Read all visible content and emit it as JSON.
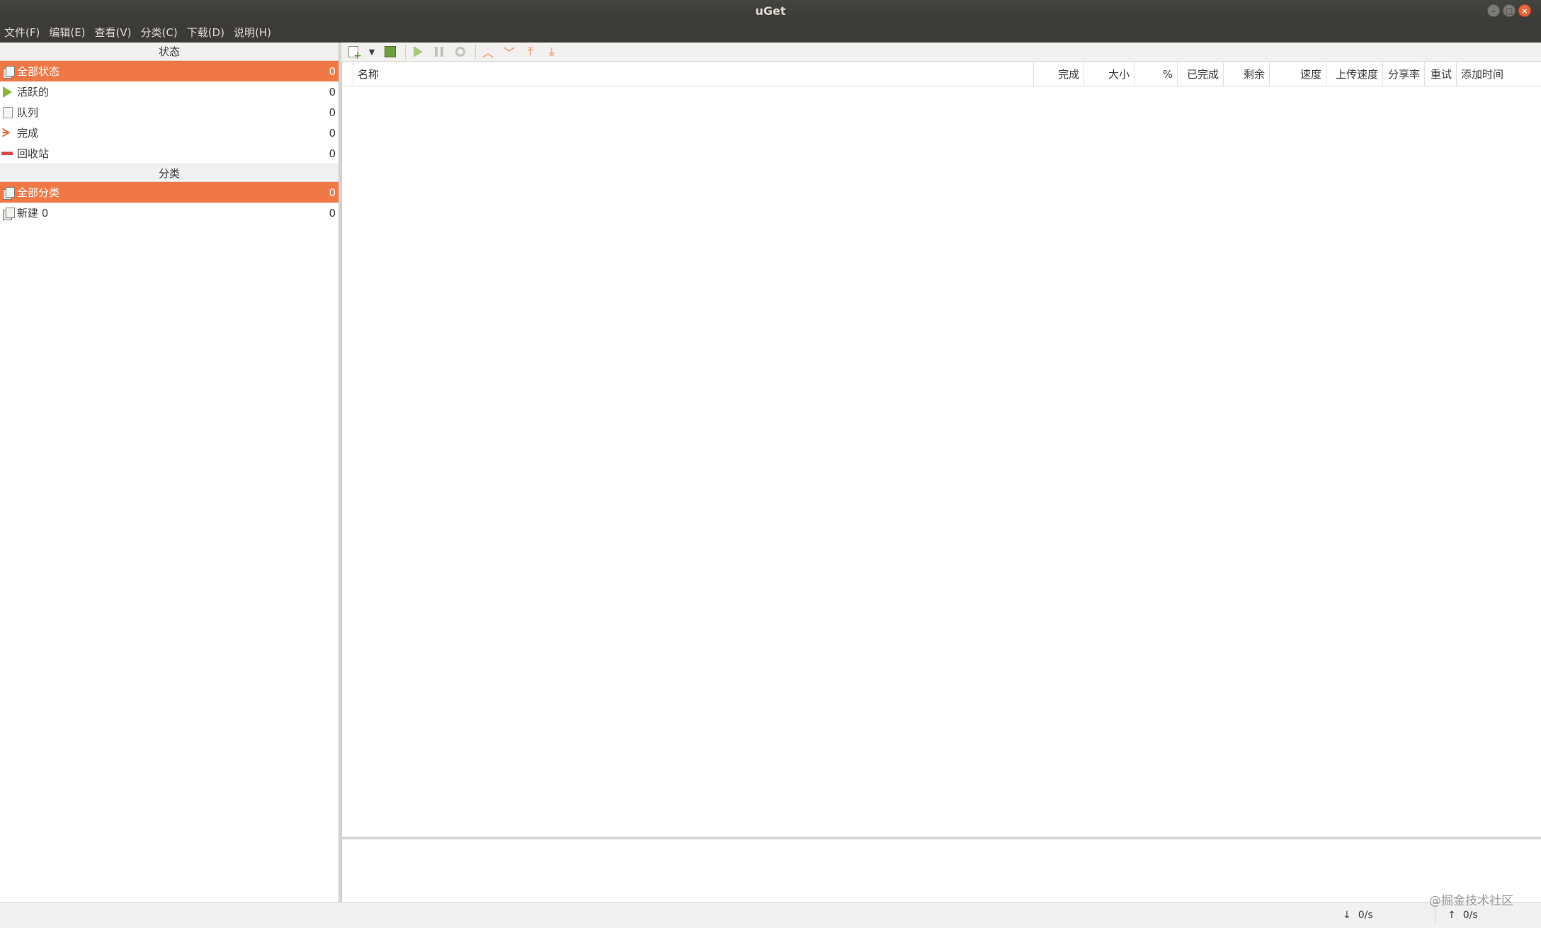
{
  "window": {
    "title": "uGet"
  },
  "menu": [
    "文件(F)",
    "编辑(E)",
    "查看(V)",
    "分类(C)",
    "下载(D)",
    "说明(H)"
  ],
  "sidebar": {
    "status_header": "状态",
    "status_items": [
      {
        "label": "全部状态",
        "count": "0",
        "icon": "all-status-icon",
        "selected": true
      },
      {
        "label": "活跃的",
        "count": "0",
        "icon": "active-icon",
        "selected": false
      },
      {
        "label": "队列",
        "count": "0",
        "icon": "queue-icon",
        "selected": false
      },
      {
        "label": "完成",
        "count": "0",
        "icon": "finished-icon",
        "selected": false
      },
      {
        "label": "回收站",
        "count": "0",
        "icon": "recycle-icon",
        "selected": false
      }
    ],
    "category_header": "分类",
    "category_items": [
      {
        "label": "全部分类",
        "count": "0",
        "icon": "all-category-icon",
        "selected": true
      },
      {
        "label": "新建 0",
        "count": "0",
        "icon": "category-icon",
        "selected": false
      }
    ]
  },
  "toolbar": {
    "buttons": [
      "new-download",
      "dropdown",
      "save",
      "start",
      "pause",
      "properties",
      "move-up",
      "move-down",
      "move-top",
      "move-bottom"
    ]
  },
  "list": {
    "columns": [
      "名称",
      "完成",
      "大小",
      "%",
      "已完成",
      "剩余",
      "速度",
      "上传速度",
      "分享率",
      "重试",
      "添加时间"
    ]
  },
  "statusbar": {
    "download_speed": "0/s",
    "upload_speed": "0/s",
    "down_arrow": "↓",
    "up_arrow": "↑",
    "watermark": "@掘金技术社区"
  },
  "colors": {
    "accent": "#f07746",
    "titlebar": "#3c3b37",
    "background": "#f2f1f0"
  }
}
